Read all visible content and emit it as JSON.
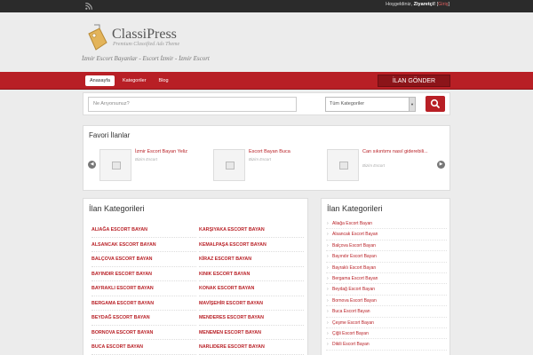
{
  "topbar": {
    "rss_icon": "rss-icon",
    "welcome_prefix": "Hoşgeldiniz,",
    "welcome_user": "Ziyaretçi!",
    "login_open": "[",
    "login_label": "Giriş",
    "login_close": "]"
  },
  "brand": {
    "logo_icon": "price-tag-icon",
    "name": "ClassiPress",
    "subtitle": "Premium Classified Ads Theme",
    "tagline": "İzmir Escort Bayanlar - Escort İzmir - İzmir Escort"
  },
  "nav": {
    "items": [
      "Anasayfa",
      "Kategoriler",
      "Blog"
    ],
    "post_button": "İLAN GÖNDER"
  },
  "search": {
    "placeholder": "Ne Arıyorsunuz?",
    "category_selected": "Tüm Kategoriler",
    "button_icon": "search-icon"
  },
  "featured": {
    "title": "Favori İlanlar",
    "items": [
      {
        "title": "İzmir Escort Bayan Yeliz",
        "category": "Bizim Escort"
      },
      {
        "title": "Escort Bayan Buca",
        "category": "Bizim Escort"
      },
      {
        "title": "Can sıkıntımı nasıl giderebili...",
        "category": "Bizim Escort"
      }
    ]
  },
  "categories": {
    "title": "İlan Kategorileri",
    "col1": [
      "ALIAĞA ESCORT BAYAN",
      "ALSANCAK ESCORT BAYAN",
      "BALÇOVA ESCORT BAYAN",
      "BAYINDIR ESCORT BAYAN",
      "BAYRAKLI ESCORT BAYAN",
      "BERGAMA ESCORT BAYAN",
      "BEYDAĞ ESCORT BAYAN",
      "BORNOVA ESCORT BAYAN",
      "BUCA ESCORT BAYAN"
    ],
    "col2": [
      "KARŞIYAKA ESCORT BAYAN",
      "KEMALPAŞA ESCORT BAYAN",
      "KİRAZ ESCORT BAYAN",
      "KINIK ESCORT BAYAN",
      "KONAK ESCORT BAYAN",
      "MAVİŞEHİR ESCORT BAYAN",
      "MENDERES ESCORT BAYAN",
      "MENEMEN ESCORT BAYAN",
      "NARLIDERE ESCORT BAYAN"
    ]
  },
  "sidebar": {
    "title": "İlan Kategorileri",
    "items": [
      "Aliağa Escort Bayan",
      "Alsancak Escort Bayan",
      "Balçova Escort Bayan",
      "Bayındır Escort Bayan",
      "Bayraklı Escort Bayan",
      "Bergama Escort Bayan",
      "Beydağ Escort Bayan",
      "Bornova Escort Bayan",
      "Buca Escort Bayan",
      "Çeşme Escort Bayan",
      "Çiğli Escort Bayan",
      "Dikili Escort Bayan"
    ]
  },
  "colors": {
    "accent": "#b81f25",
    "topbar": "#2b2b2b",
    "background": "#ececec"
  }
}
